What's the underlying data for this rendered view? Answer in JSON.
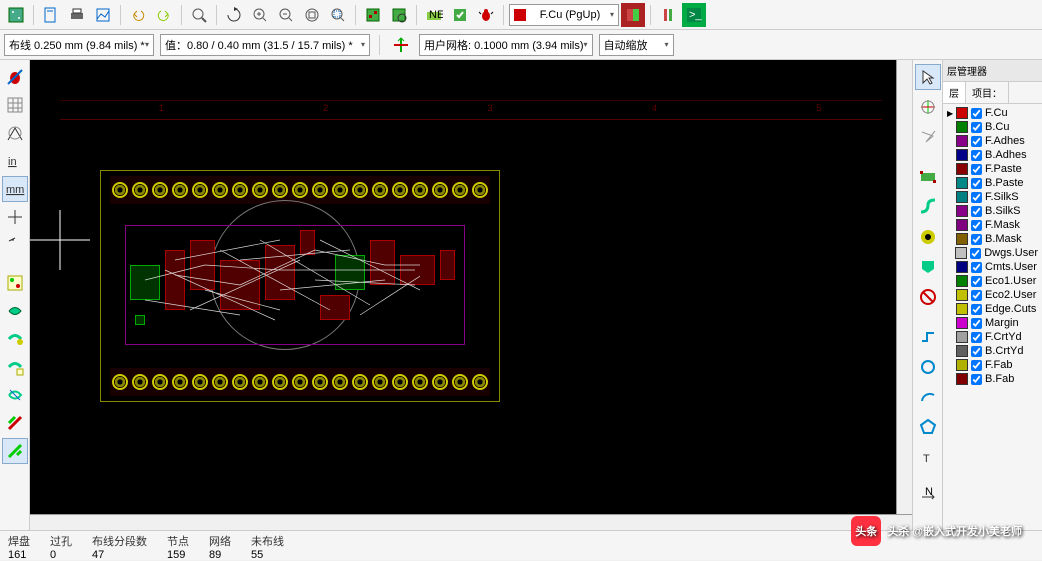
{
  "toolbar": {
    "layer_selector": "F.Cu (PgUp)"
  },
  "toolbar2": {
    "trace_label": "布线 0.250 mm (9.84 mils) *",
    "via_label": "值：0.80 / 0.40 mm (31.5 / 15.7 mils) *",
    "grid_label": "用户网格: 0.1000 mm (3.94 mils)",
    "zoom_label": "自动缩放"
  },
  "ruler_ticks": [
    "1",
    "2",
    "3",
    "4",
    "5"
  ],
  "right_panel": {
    "title": "层管理器",
    "tabs": [
      "层",
      "项目："
    ],
    "layers": [
      {
        "name": "F.Cu",
        "color": "#cc0000",
        "active": true
      },
      {
        "name": "B.Cu",
        "color": "#008000"
      },
      {
        "name": "F.Adhes",
        "color": "#880088"
      },
      {
        "name": "B.Adhes",
        "color": "#000088"
      },
      {
        "name": "F.Paste",
        "color": "#880000"
      },
      {
        "name": "B.Paste",
        "color": "#008888"
      },
      {
        "name": "F.SilkS",
        "color": "#008080"
      },
      {
        "name": "B.SilkS",
        "color": "#880088"
      },
      {
        "name": "F.Mask",
        "color": "#800080"
      },
      {
        "name": "B.Mask",
        "color": "#806000"
      },
      {
        "name": "Dwgs.User",
        "color": "#c0c0c0"
      },
      {
        "name": "Cmts.User",
        "color": "#000080"
      },
      {
        "name": "Eco1.User",
        "color": "#008000"
      },
      {
        "name": "Eco2.User",
        "color": "#c0c000"
      },
      {
        "name": "Edge.Cuts",
        "color": "#c0c000"
      },
      {
        "name": "Margin",
        "color": "#cc00cc"
      },
      {
        "name": "F.CrtYd",
        "color": "#a0a0a0"
      },
      {
        "name": "B.CrtYd",
        "color": "#606060"
      },
      {
        "name": "F.Fab",
        "color": "#b0b000"
      },
      {
        "name": "B.Fab",
        "color": "#800000"
      }
    ]
  },
  "status": {
    "pads": {
      "label": "焊盘",
      "value": "161"
    },
    "vias": {
      "label": "过孔",
      "value": "0"
    },
    "segments": {
      "label": "布线分段数",
      "value": "47"
    },
    "nodes": {
      "label": "节点",
      "value": "159"
    },
    "nets": {
      "label": "网络",
      "value": "89"
    },
    "unrouted": {
      "label": "未布线",
      "value": "55"
    }
  },
  "watermark": {
    "logo": "头条",
    "text": "头杀 @嵌入式开发小美老师"
  }
}
